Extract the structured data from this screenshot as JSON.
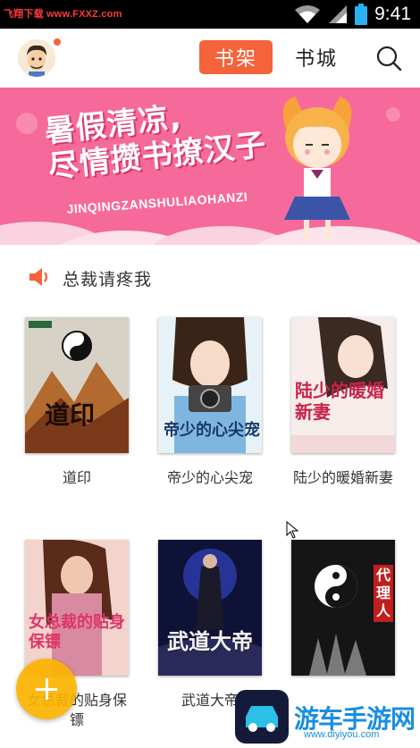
{
  "status_bar": {
    "watermark": "飞翔下载 www.FXXZ.com",
    "time": "9:41"
  },
  "header": {
    "tab_shelf": "书架",
    "tab_store": "书城",
    "icons": [
      "avatar",
      "search-icon"
    ]
  },
  "banner": {
    "line1": "暑假清凉,",
    "line2": "尽情攒书撩汉子",
    "subtitle": "JINQINGZANSHULIAOHANZI"
  },
  "section": {
    "title": "总裁请疼我",
    "icon": "speaker-icon"
  },
  "books": [
    {
      "title": "道印",
      "cover_text": "道印",
      "cover_color": "#c98a4b"
    },
    {
      "title": "帝少的心尖宠",
      "cover_text": "帝少的心尖宠",
      "cover_color": "#8fc6e8"
    },
    {
      "title": "陆少的暖婚新妻",
      "cover_text": "陆少的暖婚新妻",
      "cover_color": "#f0d6d6"
    },
    {
      "title": "女总裁的贴身保镖",
      "cover_text": "女总裁的贴身保镖",
      "cover_color": "#e9a2b4"
    },
    {
      "title": "武道大帝",
      "cover_text": "武道大帝",
      "cover_color": "#1e2a6a"
    },
    {
      "title": "阴阳代理人",
      "cover_text": "代理人",
      "cover_color": "#1b1b1b"
    }
  ],
  "bottom_watermark": {
    "text": "游车手游网",
    "url": "www.diyiyou.com"
  },
  "colors": {
    "accent": "#f4633a",
    "banner": "#f56a9a",
    "fab": "#fbb400"
  }
}
